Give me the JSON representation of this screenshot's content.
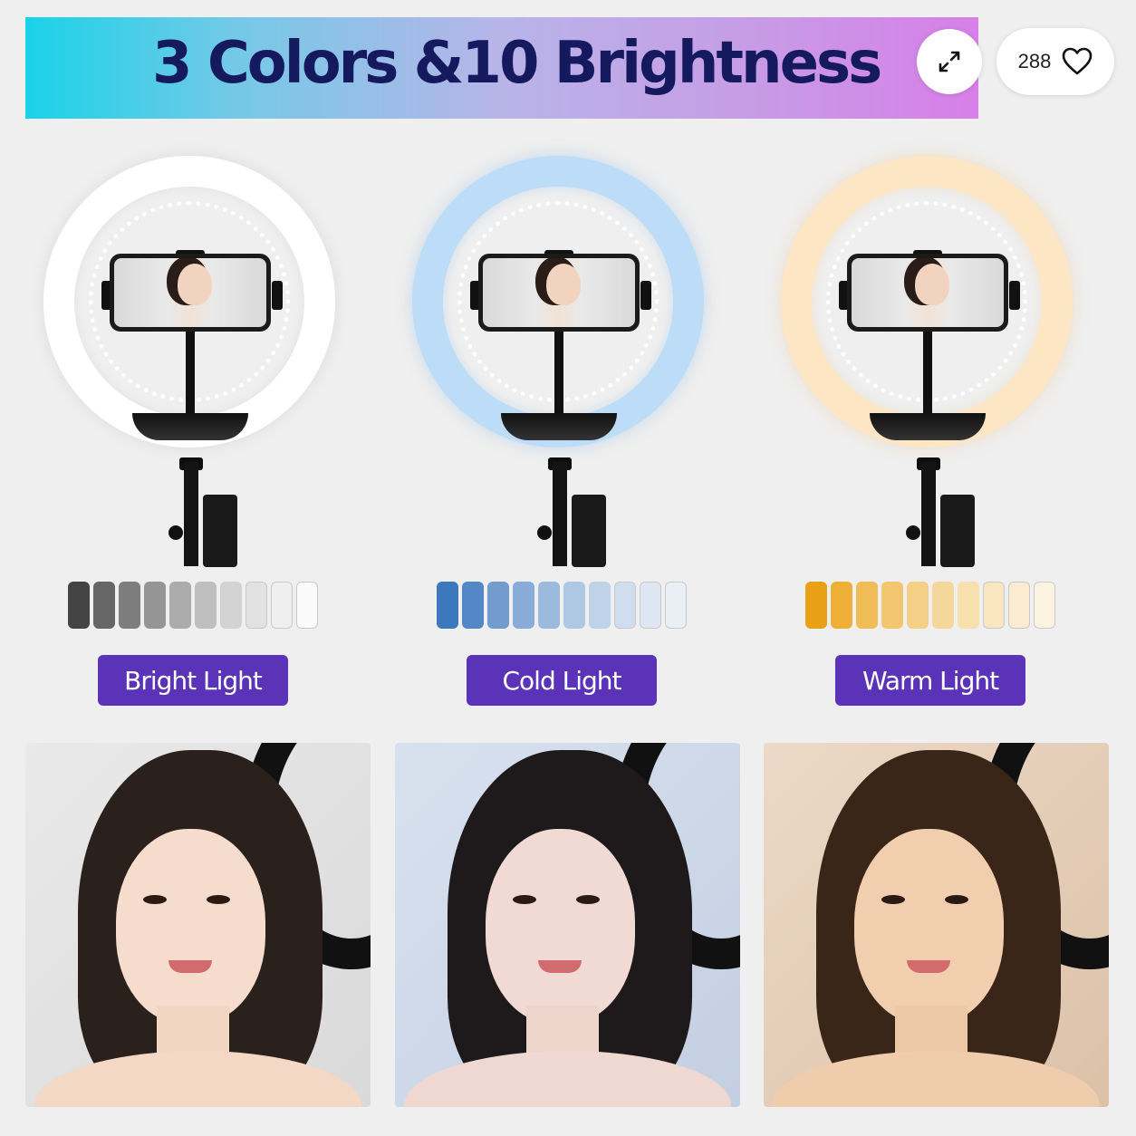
{
  "banner": {
    "title": "3 Colors &10 Brightness"
  },
  "actions": {
    "expand_icon": "expand-diagonal-arrows",
    "like_count": "288",
    "heart_icon": "heart-outline"
  },
  "modes": [
    {
      "label": "Bright Light",
      "ring_color": "#ffffff",
      "swatches": [
        "#444444",
        "#666666",
        "#7d7d7d",
        "#959595",
        "#ababab",
        "#bfbfbf",
        "#d2d2d2",
        "#e2e2e2",
        "#efefef",
        "#fafafa"
      ],
      "photo_tint": "#e8e8e8"
    },
    {
      "label": "Cold Light",
      "ring_color": "#bcdcf7",
      "swatches": [
        "#3d78bf",
        "#5487c6",
        "#729ccf",
        "#88abd7",
        "#9cbadd",
        "#aec7e3",
        "#bfd3e8",
        "#cfddee",
        "#dde6f1",
        "#eaeff6"
      ],
      "photo_tint": "#cfdaea"
    },
    {
      "label": "Warm Light",
      "ring_color": "#fde6c4",
      "swatches": [
        "#e8a116",
        "#edaf36",
        "#f0bc55",
        "#f2c66f",
        "#f4cf86",
        "#f6d79b",
        "#f8dfae",
        "#f9e6c1",
        "#fbecd1",
        "#fcf2e0"
      ],
      "photo_tint": "#ead7c4"
    }
  ]
}
